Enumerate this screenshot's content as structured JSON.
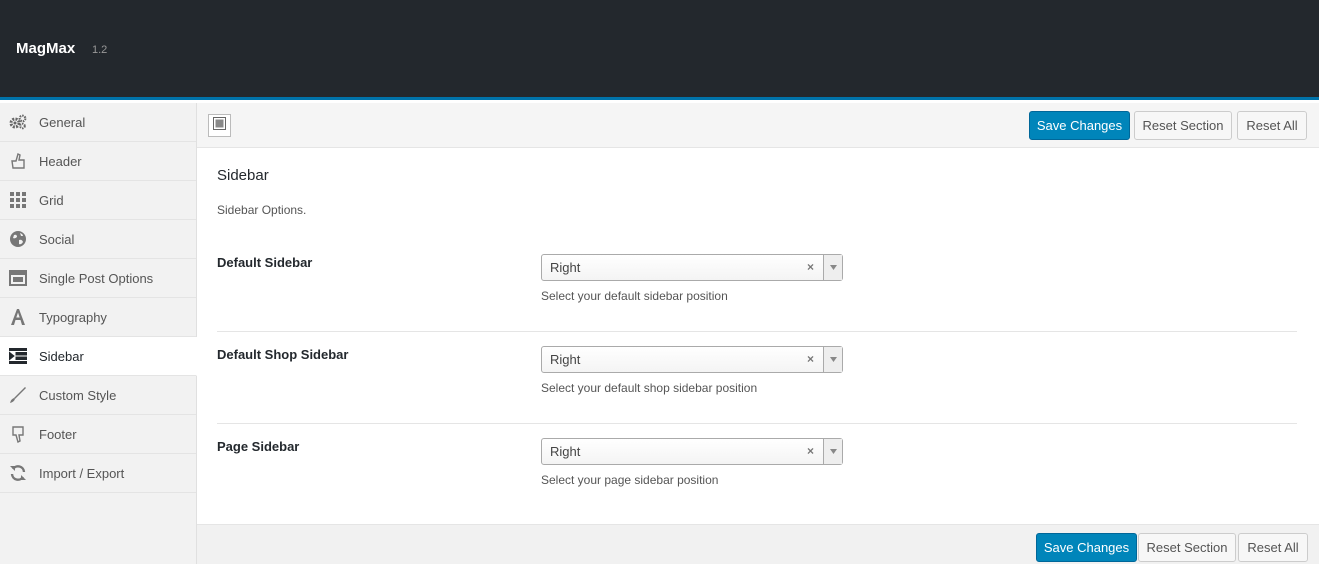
{
  "header": {
    "title": "MagMax",
    "version": "1.2"
  },
  "sidebar": {
    "items": [
      {
        "label": "General",
        "icon": "gears-icon"
      },
      {
        "label": "Header",
        "icon": "hand-pointer-icon"
      },
      {
        "label": "Grid",
        "icon": "grid-icon"
      },
      {
        "label": "Social",
        "icon": "globe-icon"
      },
      {
        "label": "Single Post Options",
        "icon": "layout-icon"
      },
      {
        "label": "Typography",
        "icon": "font-icon"
      },
      {
        "label": "Sidebar",
        "icon": "indent-icon",
        "active": true
      },
      {
        "label": "Custom Style",
        "icon": "brush-icon"
      },
      {
        "label": "Footer",
        "icon": "hand-down-icon"
      },
      {
        "label": "Import / Export",
        "icon": "refresh-icon"
      }
    ]
  },
  "toolbar": {
    "save_label": "Save Changes",
    "reset_section_label": "Reset Section",
    "reset_all_label": "Reset All"
  },
  "section": {
    "title": "Sidebar",
    "description": "Sidebar Options.",
    "fields": [
      {
        "label": "Default Sidebar",
        "value": "Right",
        "description": "Select your default sidebar position"
      },
      {
        "label": "Default Shop Sidebar",
        "value": "Right",
        "description": "Select your default shop sidebar position"
      },
      {
        "label": "Page Sidebar",
        "value": "Right",
        "description": "Select your page sidebar position"
      }
    ]
  },
  "footer": {
    "save_label": "Save Changes",
    "reset_section_label": "Reset Section",
    "reset_all_label": "Reset All"
  },
  "colors": {
    "topbar": "#23282d",
    "accent": "#0073aa",
    "primary_button": "#0085ba"
  }
}
